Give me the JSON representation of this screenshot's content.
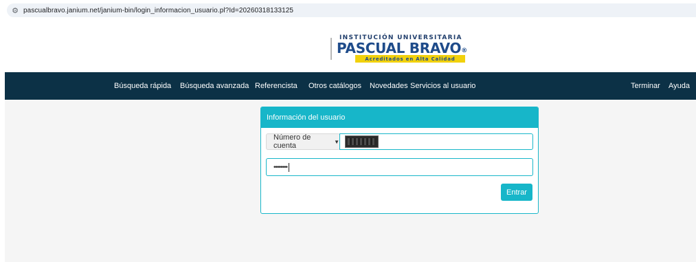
{
  "browser": {
    "url": "pascualbravo.janium.net/janium-bin/login_informacion_usuario.pl?Id=20260318133125",
    "site_settings_icon": "tune-icon"
  },
  "logo": {
    "top_line": "INSTITUCIÓN UNIVERSITARIA",
    "name": "PASCUAL BRAVO",
    "registered_mark": "®",
    "tagline": "Acreditados en Alta Calidad",
    "colors": {
      "navy": "#1e4b8a",
      "yellow": "#f1d10c"
    }
  },
  "nav": {
    "background": "#0c3146",
    "items": [
      {
        "label": "Búsqueda rápida"
      },
      {
        "label": "Búsqueda avanzada"
      },
      {
        "label": "Referencista"
      },
      {
        "label": "Otros catálogos"
      },
      {
        "label": "Novedades"
      },
      {
        "label": "Servicios al usuario"
      }
    ],
    "right_items": [
      {
        "label": "Terminar"
      },
      {
        "label": "Ayuda"
      }
    ]
  },
  "login": {
    "title": "Información del usuario",
    "account_type_selected": "Número de cuenta",
    "account_value_redacted": true,
    "password_mask": "••••••••",
    "submit_label": "Entrar",
    "accent": "#17b6c9"
  }
}
